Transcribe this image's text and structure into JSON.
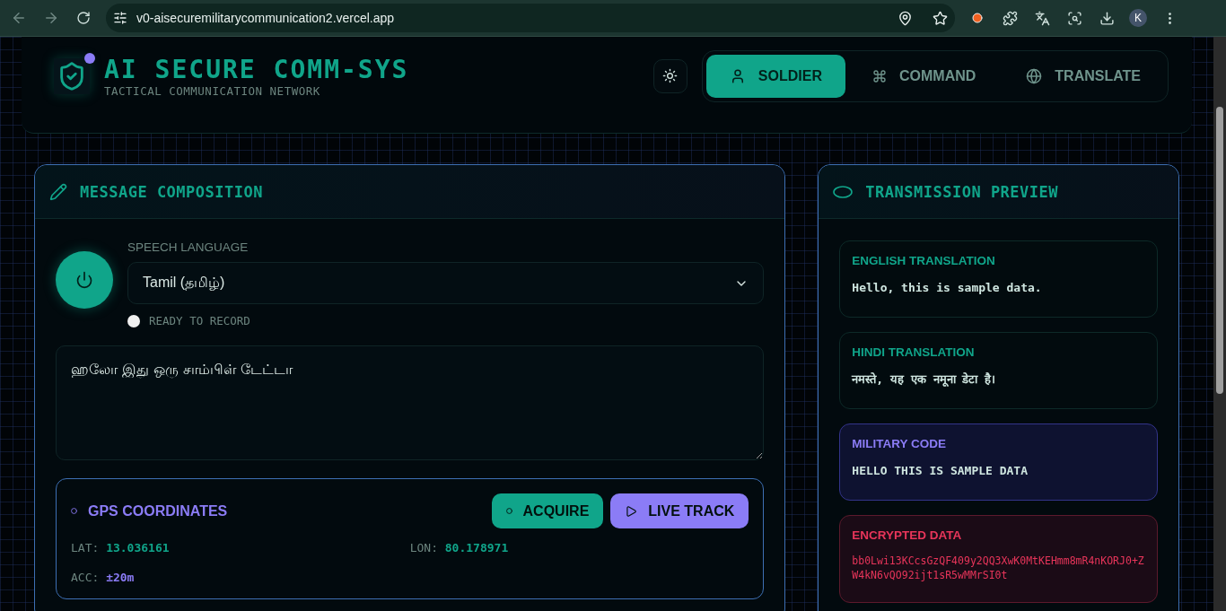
{
  "browser": {
    "url": "v0-aisecuremilitarycommunication2.vercel.app",
    "profile": "K"
  },
  "header": {
    "title": "AI SECURE COMM-SYS",
    "subtitle": "TACTICAL COMMUNICATION NETWORK",
    "tabs": [
      {
        "label": "SOLDIER",
        "kind": "user",
        "selected": true
      },
      {
        "label": "COMMAND",
        "kind": "command",
        "selected": false
      },
      {
        "label": "TRANSLATE",
        "kind": "globe",
        "selected": false
      }
    ]
  },
  "composition": {
    "title": "MESSAGE COMPOSITION",
    "language_label": "SPEECH LANGUAGE",
    "language": "Tamil (தமிழ்)",
    "recording": false,
    "status": "READY TO RECORD",
    "message": "ஹலோ இது ஒரு சாம்பிள் டேட்டா",
    "gps": {
      "title": "GPS COORDINATES",
      "buttons": [
        {
          "label": "ACQUIRE",
          "kind": "primary"
        },
        {
          "label": "LIVE TRACK",
          "kind": "secondary"
        }
      ],
      "readings": [
        {
          "label": "LAT:",
          "value": "13.036161",
          "color": "#10a58a"
        },
        {
          "label": "LON:",
          "value": "80.178971",
          "color": "#10a58a"
        },
        {
          "label": "ACC:",
          "value": "±20m",
          "color": "#8b7cf6"
        }
      ]
    }
  },
  "preview": {
    "title": "TRANSMISSION PREVIEW",
    "cards": [
      {
        "kind": "plain",
        "label": "ENGLISH TRANSLATION",
        "text": "Hello, this is sample data."
      },
      {
        "kind": "plain",
        "label": "HINDI TRANSLATION",
        "text": "नमस्ते, यह एक नमूना डेटा है।"
      },
      {
        "kind": "military",
        "label": "MILITARY CODE",
        "text": "HELLO THIS IS SAMPLE DATA"
      },
      {
        "kind": "encrypted",
        "label": "ENCRYPTED DATA",
        "text": "bb0Lwi13KCcsGzQF409y2QQ3XwK0MtKEHmm8mR4nKORJ0+ZW4kN6vQO92ijt1sR5wMMrSI0t"
      }
    ]
  }
}
